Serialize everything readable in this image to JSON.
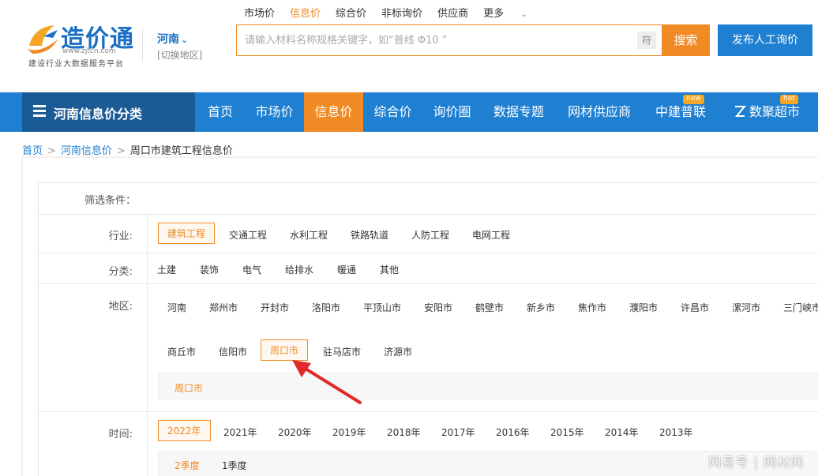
{
  "brand": {
    "name": "造价通",
    "url": "www.zjtcn.com",
    "slogan": "建设行业大数据服务平台"
  },
  "region": {
    "current": "河南",
    "switch_label": "[切换地区]"
  },
  "top_nav": [
    "市场价",
    "信息价",
    "综合价",
    "非标询价",
    "供应商",
    "更多"
  ],
  "top_nav_active": "信息价",
  "search": {
    "placeholder": "请输入材料名称规格关键字，如“普线 Φ10 ”",
    "symbol_label": "符",
    "button": "搜索"
  },
  "ask_button": "发布人工询价",
  "category_menu": "河南信息价分类",
  "main_nav": {
    "items": [
      "首页",
      "市场价",
      "信息价",
      "综合价",
      "询价圈",
      "数据专题",
      "网材供应商",
      "中建普联",
      "数聚超市"
    ],
    "active": "信息价",
    "badges": {
      "new": "new",
      "hot": "hot"
    }
  },
  "breadcrumb": {
    "home": "首页",
    "region": "河南信息价",
    "current": "周口市建筑工程信息价",
    "separator": ">"
  },
  "filters": {
    "conditions_label": "筛选条件：",
    "industry": {
      "label": "行业:",
      "options": [
        "建筑工程",
        "交通工程",
        "水利工程",
        "铁路轨道",
        "人防工程",
        "电网工程"
      ],
      "selected": "建筑工程"
    },
    "category": {
      "label": "分类:",
      "options": [
        "土建",
        "装饰",
        "电气",
        "给排水",
        "暖通",
        "其他"
      ]
    },
    "area": {
      "label": "地区:",
      "row1": [
        "河南",
        "郑州市",
        "开封市",
        "洛阳市",
        "平顶山市",
        "安阳市",
        "鹤壁市",
        "新乡市",
        "焦作市",
        "濮阳市",
        "许昌市",
        "漯河市",
        "三门峡市"
      ],
      "row2": [
        "商丘市",
        "信阳市",
        "周口市",
        "驻马店市",
        "济源市"
      ],
      "selected": "周口市",
      "sub_selected": "周口市"
    },
    "time": {
      "label": "时间:",
      "years": [
        "2022年",
        "2021年",
        "2020年",
        "2019年",
        "2018年",
        "2017年",
        "2016年",
        "2015年",
        "2014年",
        "2013年"
      ],
      "selected": "2022年",
      "quarters": [
        "2季度",
        "1季度"
      ],
      "quarter_selected": "2季度"
    }
  },
  "watermark": "网易号 | 网材网",
  "colors": {
    "brand_blue": "#1f7fd1",
    "nav_dark": "#1a5a95",
    "accent_orange": "#f08a24",
    "annotation_red": "#e02a2a"
  }
}
